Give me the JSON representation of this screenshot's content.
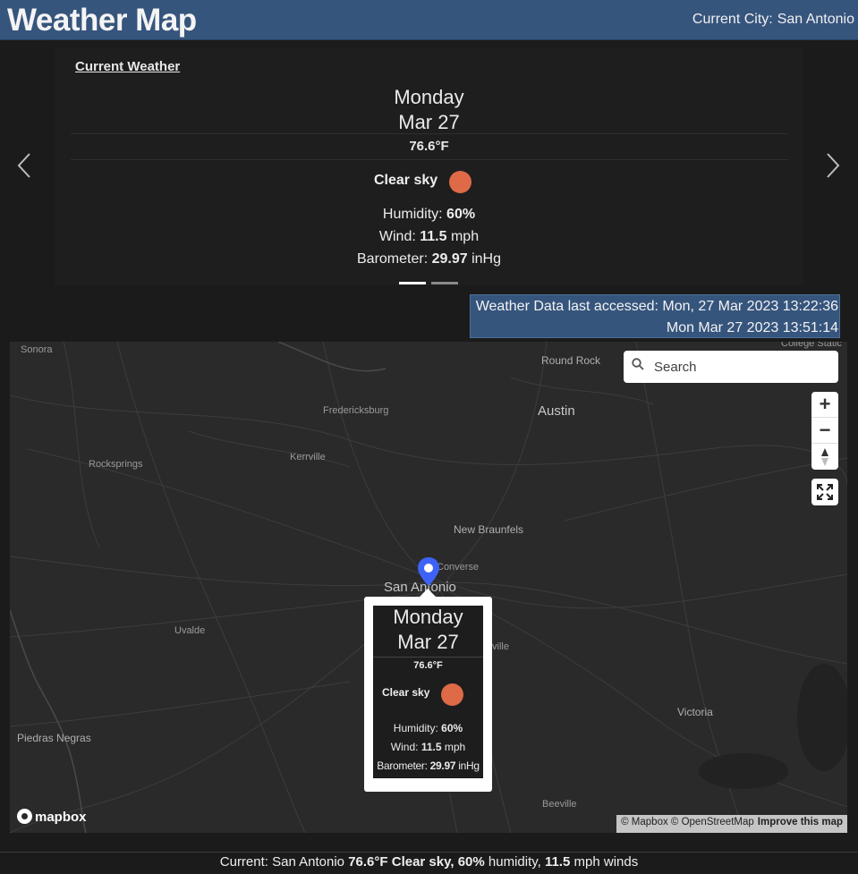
{
  "header": {
    "title": "Weather Map",
    "city_label": "Current City:",
    "city_name": "San Antonio"
  },
  "carousel": {
    "section_link": "Current Weather",
    "day": "Monday",
    "date": "Mar 27",
    "temperature": "76.6°F",
    "condition": "Clear sky",
    "condition_color": "#de6a47",
    "humidity_label": "Humidity:",
    "humidity_value": "60%",
    "wind_label": "Wind:",
    "wind_value": "11.5",
    "wind_unit": "mph",
    "barometer_label": "Barometer:",
    "barometer_value": "29.97",
    "barometer_unit": "inHg",
    "prev_icon": "chevron-left-icon",
    "next_icon": "chevron-right-icon",
    "active_slide": 1,
    "slide_count": 2
  },
  "access": {
    "line1": "Weather Data last accessed: Mon, 27 Mar 2023 13:22:36",
    "line2": "Mon Mar 27 2023 13:51:14"
  },
  "map": {
    "search_placeholder": "Search",
    "zoom_in": "+",
    "zoom_out": "−",
    "places": {
      "sonora": "Sonora",
      "college_station": "College Static",
      "round_rock": "Round Rock",
      "austin": "Austin",
      "fredericksburg": "Fredericksburg",
      "rocksprings": "Rocksprings",
      "kerrville": "Kerrville",
      "new_braunfels": "New Braunfels",
      "converse": "Converse",
      "san_antonio": "San Antonio",
      "uvalde": "Uvalde",
      "ville": "ville",
      "victoria": "Victoria",
      "piedras_negras": "Piedras Negras",
      "beeville": "Beeville"
    },
    "logo_text": "mapbox",
    "attribution": "© Mapbox © OpenStreetMap",
    "improve_link": "Improve this map",
    "popup": {
      "day": "Monday",
      "date": "Mar 27",
      "temperature": "76.6°F",
      "condition": "Clear sky",
      "humidity_label": "Humidity:",
      "humidity_value": "60%",
      "wind_label": "Wind:",
      "wind_value": "11.5",
      "wind_unit": "mph",
      "barometer_label": "Barometer:",
      "barometer_value": "29.97",
      "barometer_unit": "inHg"
    },
    "marker_color": "#3d62f5"
  },
  "footer": {
    "prefix": "Current: San Antonio",
    "temp": "76.6°F",
    "condition": "Clear sky,",
    "humidity": "60%",
    "humidity_text": "humidity,",
    "wind": "11.5",
    "wind_text": "mph winds"
  }
}
